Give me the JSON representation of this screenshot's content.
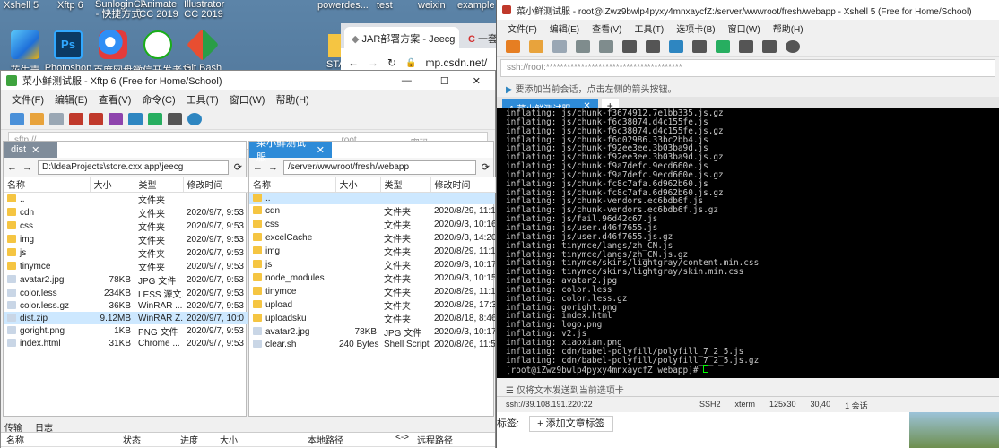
{
  "desktop": {
    "top_labels": [
      "Xshell 5",
      "Xftp 6",
      "SunloginCl... - 快捷方式",
      "Animate CC 2019",
      "Illustrator CC 2019",
      "powerdes...",
      "test",
      "weixin",
      "example"
    ],
    "icons": [
      {
        "label": "花生壳",
        "icon": "peanut-shell-icon",
        "color": "#2c8fe3"
      },
      {
        "label": "Photoshop",
        "icon": "photoshop-icon",
        "color": "#0b3a64"
      },
      {
        "label": "百度网盘",
        "icon": "baidu-netdisk-icon",
        "color": "#2f8ef5"
      },
      {
        "label": "微信开发者工",
        "icon": "wechat-devtools-icon",
        "color": "#ffffff"
      },
      {
        "label": "Git Bash",
        "icon": "git-bash-icon",
        "color": "#e84e31"
      }
    ],
    "sta_label": "STA"
  },
  "browser": {
    "tab1": "JAR部署方案 - Jeecg",
    "tab2": "一套前",
    "url": "mp.csdn.net/",
    "tag_label": "标签:",
    "add_tag_button": "+ 添加文章标签"
  },
  "xftp": {
    "title": "菜小鲜测试服 - Xftp 6 (Free for Home/School)",
    "menu": [
      "文件(F)",
      "编辑(E)",
      "查看(V)",
      "命令(C)",
      "工具(T)",
      "窗口(W)",
      "帮助(H)"
    ],
    "address_placeholder": "sftp://",
    "user_placeholder": "root",
    "password_placeholder": "密码",
    "left_tab": "dist",
    "left_path": "D:\\IdeaProjects\\store.cxx.app\\jeecg",
    "right_tab": "菜小鲜测试服",
    "right_path": "/server/wwwroot/fresh/webapp",
    "columns_left": [
      "名称",
      "大小",
      "类型",
      "修改时间"
    ],
    "columns_right": [
      "名称",
      "大小",
      "类型",
      "修改时间"
    ],
    "left_files": [
      {
        "name": "..",
        "size": "",
        "type": "文件夹",
        "date": "",
        "folder": true
      },
      {
        "name": "cdn",
        "size": "",
        "type": "文件夹",
        "date": "2020/9/7, 9:53",
        "folder": true
      },
      {
        "name": "css",
        "size": "",
        "type": "文件夹",
        "date": "2020/9/7, 9:53",
        "folder": true
      },
      {
        "name": "img",
        "size": "",
        "type": "文件夹",
        "date": "2020/9/7, 9:53",
        "folder": true
      },
      {
        "name": "js",
        "size": "",
        "type": "文件夹",
        "date": "2020/9/7, 9:53",
        "folder": true
      },
      {
        "name": "tinymce",
        "size": "",
        "type": "文件夹",
        "date": "2020/9/7, 9:53",
        "folder": true
      },
      {
        "name": "avatar2.jpg",
        "size": "78KB",
        "type": "JPG 文件",
        "date": "2020/9/7, 9:53",
        "folder": false
      },
      {
        "name": "color.less",
        "size": "234KB",
        "type": "LESS 源文...",
        "date": "2020/9/7, 9:53",
        "folder": false
      },
      {
        "name": "color.less.gz",
        "size": "36KB",
        "type": "WinRAR ...",
        "date": "2020/9/7, 9:53",
        "folder": false
      },
      {
        "name": "dist.zip",
        "size": "9.12MB",
        "type": "WinRAR Z...",
        "date": "2020/9/7, 10:0",
        "folder": false,
        "selected": true
      },
      {
        "name": "goright.png",
        "size": "1KB",
        "type": "PNG 文件",
        "date": "2020/9/7, 9:53",
        "folder": false
      },
      {
        "name": "index.html",
        "size": "31KB",
        "type": "Chrome ...",
        "date": "2020/9/7, 9:53",
        "folder": false
      }
    ],
    "right_files": [
      {
        "name": "..",
        "size": "",
        "type": "",
        "date": "",
        "folder": true,
        "selected": true
      },
      {
        "name": "cdn",
        "size": "",
        "type": "文件夹",
        "date": "2020/8/29, 11:1",
        "folder": true
      },
      {
        "name": "css",
        "size": "",
        "type": "文件夹",
        "date": "2020/9/3, 10:16",
        "folder": true
      },
      {
        "name": "excelCache",
        "size": "",
        "type": "文件夹",
        "date": "2020/9/3, 14:20",
        "folder": true
      },
      {
        "name": "img",
        "size": "",
        "type": "文件夹",
        "date": "2020/8/29, 11:1",
        "folder": true
      },
      {
        "name": "js",
        "size": "",
        "type": "文件夹",
        "date": "2020/9/3, 10:17",
        "folder": true
      },
      {
        "name": "node_modules",
        "size": "",
        "type": "文件夹",
        "date": "2020/9/3, 10:15",
        "folder": true
      },
      {
        "name": "tinymce",
        "size": "",
        "type": "文件夹",
        "date": "2020/8/29, 11:1",
        "folder": true
      },
      {
        "name": "upload",
        "size": "",
        "type": "文件夹",
        "date": "2020/8/28, 17:3",
        "folder": true
      },
      {
        "name": "uploadsku",
        "size": "",
        "type": "文件夹",
        "date": "2020/8/18, 8:46",
        "folder": true
      },
      {
        "name": "avatar2.jpg",
        "size": "78KB",
        "type": "JPG 文件",
        "date": "2020/9/3, 10:17",
        "folder": false
      },
      {
        "name": "clear.sh",
        "size": "240 Bytes",
        "type": "Shell Script",
        "date": "2020/8/26, 11:5",
        "folder": false
      }
    ],
    "bottom_tabs": [
      "传输",
      "日志"
    ],
    "transfer_columns": [
      "名称",
      "状态",
      "进度",
      "大小",
      "本地路径",
      "<->",
      "远程路径"
    ]
  },
  "xshell": {
    "title": "菜小鲜测试服 - root@iZwz9bwlp4pyxy4mnxaycfZ:/server/wwwroot/fresh/webapp - Xshell 5 (Free for Home/School)",
    "menu": [
      "文件(F)",
      "编辑(E)",
      "查看(V)",
      "工具(T)",
      "选项卡(B)",
      "窗口(W)",
      "帮助(H)"
    ],
    "address": "ssh://root:***************************************",
    "hint": "要添加当前会话，点击左侧的箭头按钮。",
    "tab_label": "1 菜小鲜测试服",
    "terminal_lines": [
      "inflating: js/chunk-f3674912.7e1bb335.js.gz",
      "inflating: js/chunk-f6c38074.d4c155fe.js",
      "inflating: js/chunk-f6c38074.d4c155fe.js.gz",
      "inflating: js/chunk-f6d02986.33bc2bb4.js",
      "inflating: js/chunk-f92ee3ee.3b03ba9d.js",
      "inflating: js/chunk-f92ee3ee.3b03ba9d.js.gz",
      "inflating: js/chunk-f9a7defc.9ecd660e.js",
      "inflating: js/chunk-f9a7defc.9ecd660e.js.gz",
      "inflating: js/chunk-fc8c7afa.6d962b60.js",
      "inflating: js/chunk-fc8c7afa.6d962b60.js.gz",
      "inflating: js/chunk-vendors.ec6bdb6f.js",
      "inflating: js/chunk-vendors.ec6bdb6f.js.gz",
      "inflating: js/fail.96d42c67.js",
      "inflating: js/user.d46f7655.js",
      "inflating: js/user.d46f7655.js.gz",
      "inflating: tinymce/langs/zh_CN.js",
      "inflating: tinymce/langs/zh_CN.js.gz",
      "inflating: tinymce/skins/lightgray/content.min.css",
      "inflating: tinymce/skins/lightgray/skin.min.css",
      "inflating: avatar2.jpg",
      "inflating: color.less",
      "inflating: color.less.gz",
      "inflating: goright.png",
      "inflating: index.html",
      "inflating: logo.png",
      "inflating: v2.js",
      "inflating: xiaoxian.png",
      "inflating: cdn/babel-polyfill/polyfill_7_2_5.js",
      "inflating: cdn/babel-polyfill/polyfill_7_2_5.js.gz"
    ],
    "prompt": "[root@iZwz9bwlp4pyxy4mnxaycfZ webapp]# ",
    "send_hint": "仅将文本发送到当前选项卡",
    "status": {
      "host": "ssh://39.108.191.220:22",
      "proto": "SSH2",
      "term": "xterm",
      "size": "125x30",
      "pos": "30,40",
      "sessions": "1 会话"
    }
  },
  "colors": {
    "xftp_tab": "#2e8bd8",
    "xshell_tab": "#2e8bd8",
    "term_bg": "#000000",
    "term_fg": "#c8c8c8",
    "cursor": "#00ff00"
  }
}
